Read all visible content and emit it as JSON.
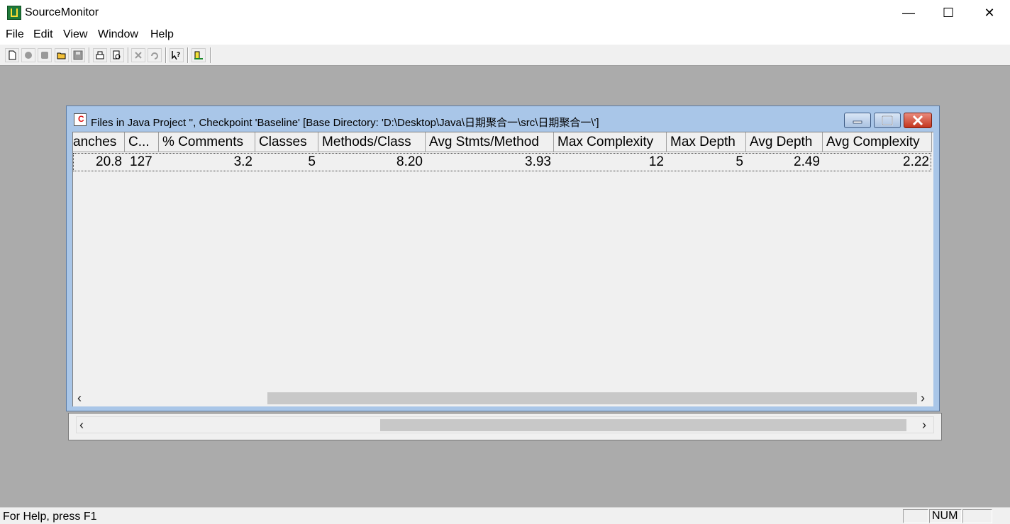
{
  "app": {
    "title": "SourceMonitor",
    "window_buttons": {
      "minimize": "—",
      "maximize": "☐",
      "close": "✕"
    }
  },
  "menu": [
    "File",
    "Edit",
    "View",
    "Window",
    "Help"
  ],
  "toolbar_icons": [
    "new-file-icon",
    "run-checkpoint-icon",
    "stop-icon",
    "open-folder-icon",
    "save-icon",
    "print-icon",
    "print-preview-icon",
    "delete-icon",
    "undo-icon",
    "context-help-icon",
    "chart-icon"
  ],
  "child_window": {
    "title": "Files in Java Project '', Checkpoint 'Baseline'  [Base Directory: 'D:\\Desktop\\Java\\日期聚合一\\src\\日期聚合一\\']"
  },
  "table": {
    "columns": [
      "anches",
      "C...",
      "% Comments",
      "Classes",
      "Methods/Class",
      "Avg Stmts/Method",
      "Max Complexity",
      "Max Depth",
      "Avg Depth",
      "Avg Complexity"
    ],
    "rows": [
      [
        "20.8",
        "127",
        "3.2",
        "5",
        "8.20",
        "3.93",
        "12",
        "5",
        "2.49",
        "2.22"
      ]
    ]
  },
  "status": {
    "help_text": "For Help, press F1",
    "num": "NUM"
  }
}
